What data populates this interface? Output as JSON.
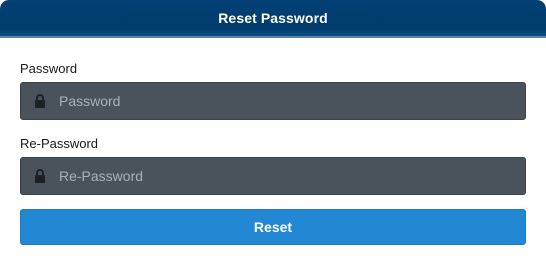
{
  "header": {
    "title": "Reset Password"
  },
  "form": {
    "password": {
      "label": "Password",
      "placeholder": "Password",
      "value": "",
      "icon": "lock-icon"
    },
    "repassword": {
      "label": "Re-Password",
      "placeholder": "Re-Password",
      "value": "",
      "icon": "lock-icon"
    },
    "reset_label": "Reset"
  },
  "colors": {
    "header_bg": "#013f74",
    "input_bg": "#4a535c",
    "button_bg": "#2388d3"
  }
}
